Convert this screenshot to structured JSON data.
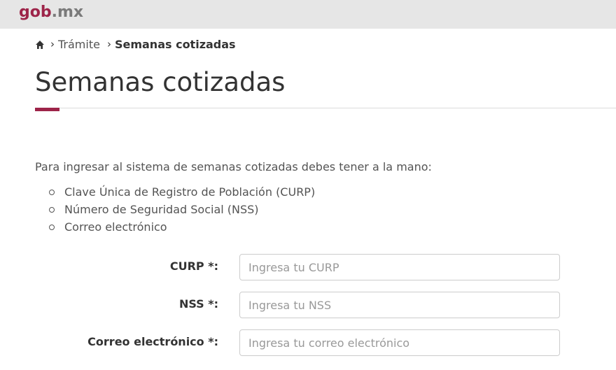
{
  "header": {
    "logo_part1": "gob",
    "logo_part2": ".mx"
  },
  "breadcrumb": {
    "sep": "›",
    "items": [
      "Trámite",
      "Semanas cotizadas"
    ]
  },
  "page": {
    "title": "Semanas cotizadas"
  },
  "intro": "Para ingresar al sistema de semanas cotizadas debes tener a la mano:",
  "requirements": [
    "Clave Única de Registro de Población (CURP)",
    "Número de Seguridad Social (NSS)",
    "Correo electrónico"
  ],
  "form": {
    "curp": {
      "label": "CURP *:",
      "placeholder": "Ingresa tu CURP",
      "value": ""
    },
    "nss": {
      "label": "NSS *:",
      "placeholder": "Ingresa tu NSS",
      "value": ""
    },
    "email": {
      "label": "Correo electrónico *:",
      "placeholder": "Ingresa tu correo electrónico",
      "value": ""
    }
  },
  "colors": {
    "brand": "#9d2449",
    "header_bg": "#e6e6e6"
  },
  "icons": {
    "home": "home-icon"
  }
}
